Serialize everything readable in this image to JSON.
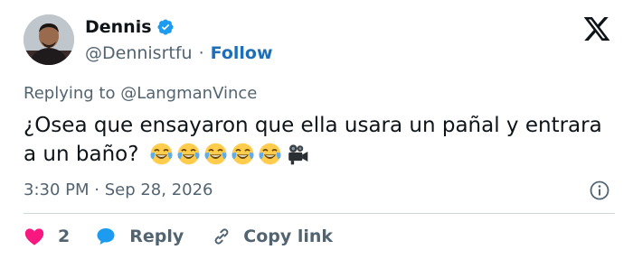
{
  "author": {
    "display_name": "Dennis",
    "handle": "@Dennisrtfu",
    "separator": "·",
    "follow_label": "Follow",
    "verified": true
  },
  "reply_context": "Replying to @LangmanVince",
  "tweet": {
    "text": "¿Osea que ensayaron que ella usara un pañal y entrara a un baño?",
    "emojis": [
      "face-with-tears-of-joy",
      "face-with-tears-of-joy",
      "face-with-tears-of-joy",
      "face-with-tears-of-joy",
      "face-with-tears-of-joy",
      "movie-camera"
    ]
  },
  "timestamp": "3:30 PM · Sep 28, 2026",
  "actions": {
    "like_count": "2",
    "reply_label": "Reply",
    "copy_link_label": "Copy link"
  },
  "colors": {
    "text": "#0f1419",
    "secondary": "#536471",
    "link": "#1d6fb8",
    "verified": "#1d9bf0",
    "like": "#f91880",
    "reply_icon": "#1d9bf0"
  }
}
